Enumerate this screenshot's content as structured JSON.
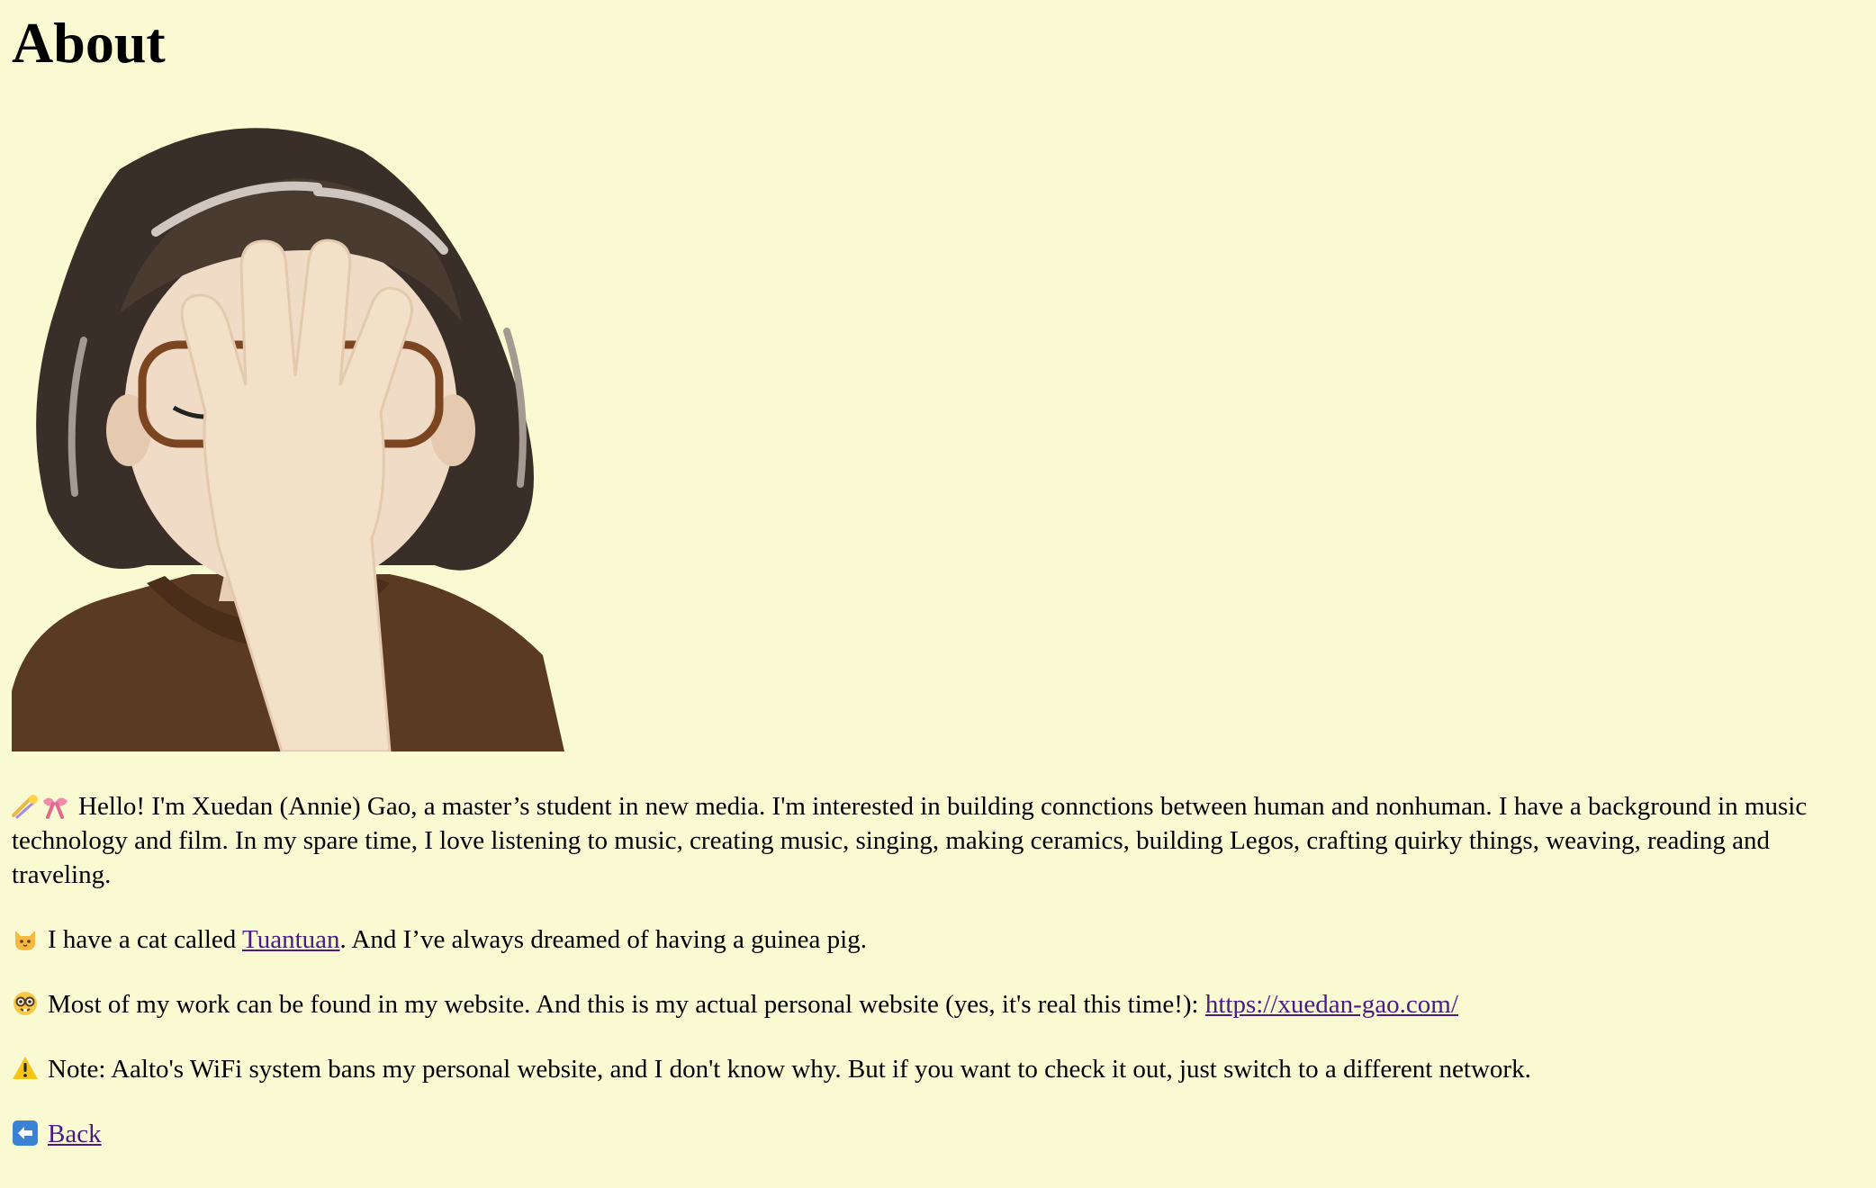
{
  "page": {
    "title": "About"
  },
  "avatar": {
    "alt": "memoji facepalm"
  },
  "intro": {
    "text": "Hello! I'm Xuedan (Annie) Gao, a master’s student in new media. I'm interested in building connctions between human and nonhuman. I have a background in music technology and film. In my spare time, I love listening to music, creating music, singing, making ceramics, building Legos, crafting quirky things, weaving, reading and traveling.",
    "emojis": [
      "comet-emoji",
      "ribbon-emoji"
    ]
  },
  "cat": {
    "before": "I have a cat called ",
    "link": "Tuantuan",
    "after": ". And I’ve always dreamed of having a guinea pig.",
    "emoji": "cat-face-emoji"
  },
  "work": {
    "before": "Most of my work can be found in my website. And this is my actual personal website (yes, it's real this time!): ",
    "link": "https://xuedan-gao.com/",
    "emoji": "nerd-face-emoji"
  },
  "note": {
    "text": "Note: Aalto's WiFi system bans my personal website, and I don't know why. But if you want to check it out, just switch to a different network.",
    "emoji": "warning-emoji"
  },
  "back": {
    "link": "Back",
    "emoji": "left-arrow-emoji"
  },
  "colors": {
    "background": "#fafad2",
    "link": "#4a1a85",
    "text": "#000000"
  }
}
